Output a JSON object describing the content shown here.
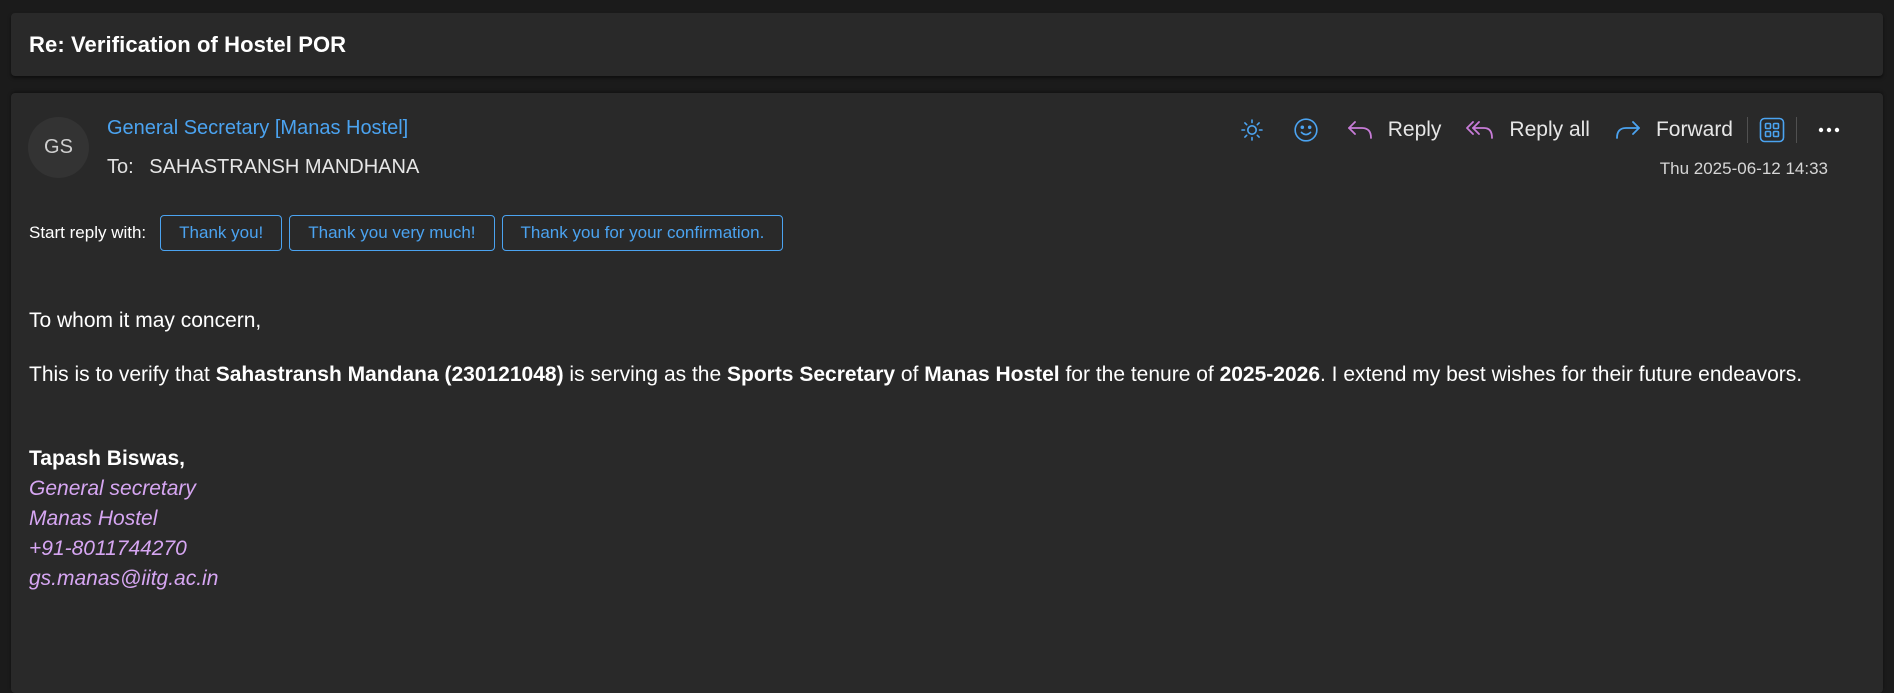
{
  "subject": "Re: Verification of Hostel POR",
  "message": {
    "avatar_initials": "GS",
    "sender": "General Secretary [Manas Hostel]",
    "to_label": "To:",
    "to": "SAHASTRANSH MANDHANA",
    "date": "Thu 2025-06-12 14:33",
    "actions": {
      "reply": "Reply",
      "reply_all": "Reply all",
      "forward": "Forward"
    }
  },
  "quick_reply": {
    "label": "Start reply with:",
    "suggestions": [
      "Thank you!",
      "Thank you very much!",
      "Thank you for your confirmation."
    ]
  },
  "body": {
    "greeting": "To whom it may concern,",
    "p2": {
      "t1": "This is to verify that ",
      "b1": "Sahastransh Mandana (230121048)",
      "t2": " is serving as the ",
      "b2": "Sports Secretary",
      "t3": " of ",
      "b3": "Manas Hostel",
      "t4": " for the tenure of ",
      "b4": "2025-2026",
      "t5": ". I extend my best wishes for their future endeavors."
    },
    "signature": {
      "name": "Tapash Biswas,",
      "lines": [
        "General secretary",
        "Manas Hostel",
        "+91-8011744270",
        "gs.manas@iitg.ac.in"
      ]
    }
  },
  "colors": {
    "accent": "#4ba3f0",
    "signature": "#d6a6f2",
    "reply_icon": "#c87cd8",
    "background": "#292929"
  },
  "icons": [
    "brightness-icon",
    "emoji-icon",
    "reply-icon",
    "reply-all-icon",
    "forward-icon",
    "apps-icon",
    "more-icon"
  ]
}
